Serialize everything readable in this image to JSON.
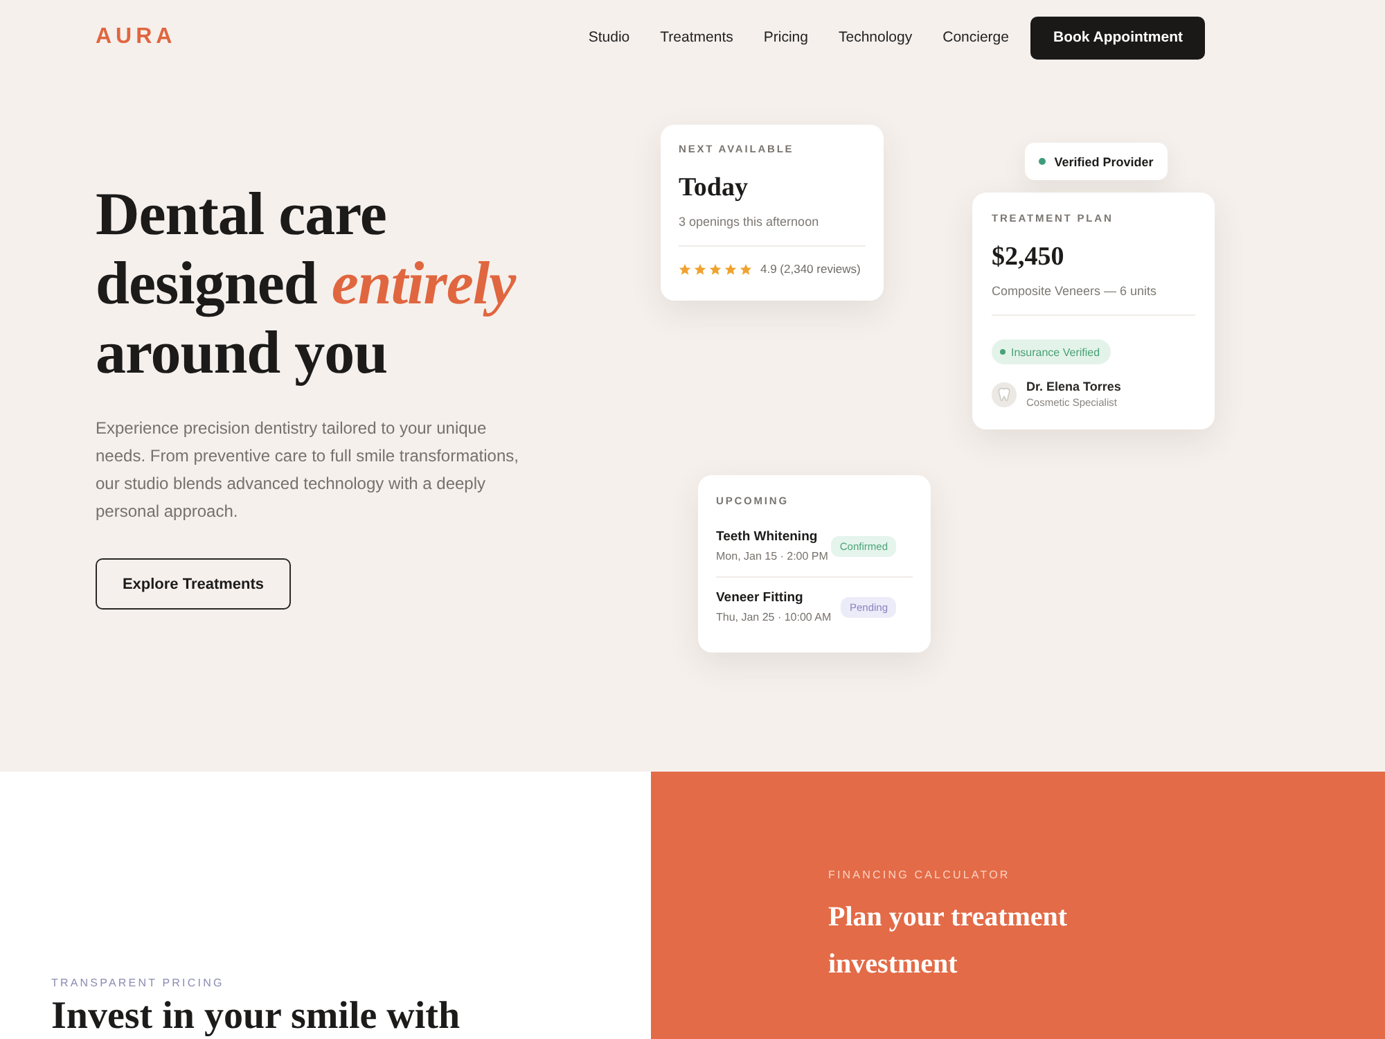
{
  "nav": {
    "logo": "AURA",
    "links": [
      "Studio",
      "Treatments",
      "Pricing",
      "Technology",
      "Concierge"
    ],
    "cta": "Book Appointment"
  },
  "hero": {
    "headline": "Dental care designed *entirely* around you",
    "description": "Experience precision dentistry tailored to your unique needs. From preventive care to full smile transformations, our studio blends advanced technology with a deeply personal approach.",
    "button": "Explore Treatments"
  },
  "next_available": {
    "label": "NEXT AVAILABLE",
    "day": "Today",
    "openings": "3 openings this afternoon",
    "stars": 5,
    "rating": "4.9 (2,340 reviews)"
  },
  "verified_badge": "Verified Provider",
  "treatment_plan": {
    "label": "TREATMENT PLAN",
    "price": "$2,450",
    "description": "Composite Veneers — 6 units",
    "insurance": "Insurance Verified",
    "provider_name": "Dr. Elena Torres",
    "provider_role": "Cosmetic Specialist"
  },
  "upcoming": {
    "label": "UPCOMING",
    "appointments": [
      {
        "title": "Teeth Whitening",
        "time": "Mon, Jan 15 · 2:00 PM",
        "status": "Confirmed",
        "kind": "confirmed"
      },
      {
        "title": "Veneer Fitting",
        "time": "Thu, Jan 25 · 10:00 AM",
        "status": "Pending",
        "kind": "pending"
      }
    ]
  },
  "pricing": {
    "eyebrow": "TRANSPARENT PRICING",
    "heading": "Invest in your smile with"
  },
  "financing": {
    "eyebrow": "FINANCING CALCULATOR",
    "heading": "Plan your treatment investment"
  }
}
